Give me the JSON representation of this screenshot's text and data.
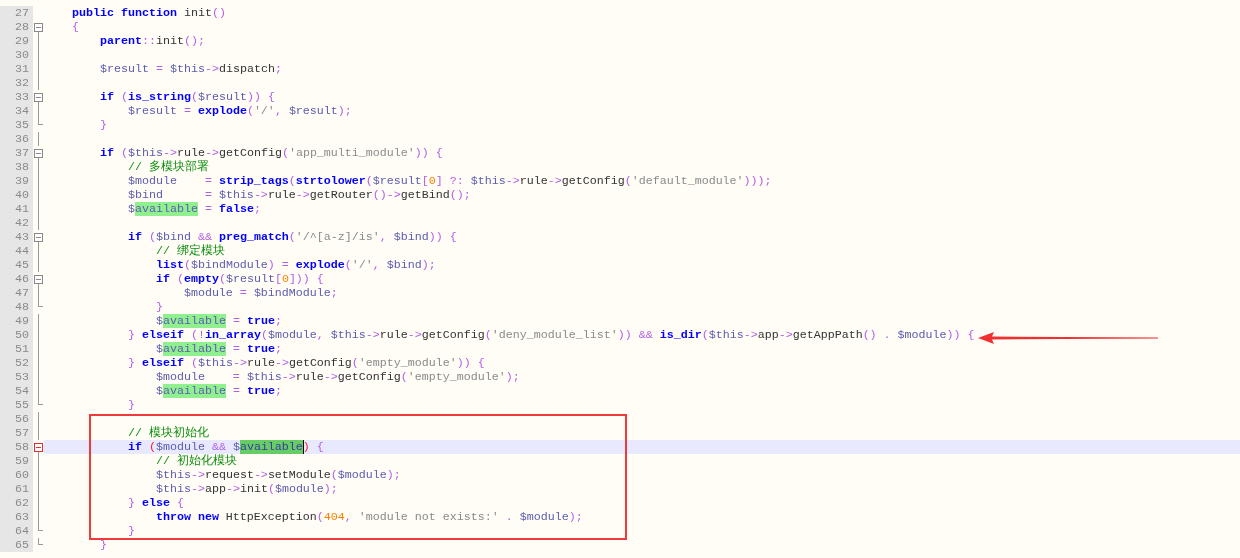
{
  "editor": {
    "lines": [
      {
        "n": "27",
        "foldable": false,
        "fold_end": false,
        "in_fold": false,
        "current": false,
        "tokens": [
          {
            "kind": "kw",
            "text": "    public function"
          },
          {
            "kind": "plain",
            "text": " init"
          },
          {
            "kind": "op",
            "text": "()"
          }
        ]
      },
      {
        "n": "28",
        "foldable": true,
        "fold_end": false,
        "in_fold": true,
        "current": false,
        "tokens": [
          {
            "kind": "op",
            "text": "    {"
          }
        ]
      },
      {
        "n": "29",
        "foldable": false,
        "fold_end": false,
        "in_fold": true,
        "current": false,
        "tokens": [
          {
            "kind": "kw",
            "text": "        parent"
          },
          {
            "kind": "op",
            "text": "::"
          },
          {
            "kind": "plain",
            "text": "init"
          },
          {
            "kind": "op",
            "text": "();"
          }
        ]
      },
      {
        "n": "30",
        "foldable": false,
        "fold_end": false,
        "in_fold": true,
        "current": false
      },
      {
        "n": "31",
        "foldable": false,
        "fold_end": false,
        "in_fold": true,
        "current": false,
        "tokens": [
          {
            "kind": "var",
            "text": "        $result"
          },
          {
            "kind": "op",
            "text": " = "
          },
          {
            "kind": "var",
            "text": "$this"
          },
          {
            "kind": "op",
            "text": "->"
          },
          {
            "kind": "plain",
            "text": "dispatch"
          },
          {
            "kind": "op",
            "text": ";"
          }
        ]
      },
      {
        "n": "32",
        "foldable": false,
        "fold_end": false,
        "in_fold": true,
        "current": false
      },
      {
        "n": "33",
        "foldable": true,
        "fold_end": false,
        "in_fold": true,
        "current": false,
        "tokens": [
          {
            "kind": "kw",
            "text": "        if"
          },
          {
            "kind": "op",
            "text": " ("
          },
          {
            "kind": "kw",
            "text": "is_string"
          },
          {
            "kind": "op",
            "text": "("
          },
          {
            "kind": "var",
            "text": "$result"
          },
          {
            "kind": "op",
            "text": ")) {"
          }
        ]
      },
      {
        "n": "34",
        "foldable": false,
        "fold_end": false,
        "in_fold": true,
        "current": false,
        "tokens": [
          {
            "kind": "var",
            "text": "            $result"
          },
          {
            "kind": "op",
            "text": " = "
          },
          {
            "kind": "kw",
            "text": "explode"
          },
          {
            "kind": "op",
            "text": "("
          },
          {
            "kind": "str",
            "text": "'/'"
          },
          {
            "kind": "op",
            "text": ", "
          },
          {
            "kind": "var",
            "text": "$result"
          },
          {
            "kind": "op",
            "text": ");"
          }
        ]
      },
      {
        "n": "35",
        "foldable": false,
        "fold_end": true,
        "in_fold": true,
        "current": false,
        "tokens": [
          {
            "kind": "op",
            "text": "        }"
          }
        ]
      },
      {
        "n": "36",
        "foldable": false,
        "fold_end": false,
        "in_fold": true,
        "current": false
      },
      {
        "n": "37",
        "foldable": true,
        "fold_end": false,
        "in_fold": true,
        "current": false,
        "tokens": [
          {
            "kind": "kw",
            "text": "        if"
          },
          {
            "kind": "op",
            "text": " ("
          },
          {
            "kind": "var",
            "text": "$this"
          },
          {
            "kind": "op",
            "text": "->"
          },
          {
            "kind": "plain",
            "text": "rule"
          },
          {
            "kind": "op",
            "text": "->"
          },
          {
            "kind": "plain",
            "text": "getConfig"
          },
          {
            "kind": "op",
            "text": "("
          },
          {
            "kind": "str",
            "text": "'app_multi_module'"
          },
          {
            "kind": "op",
            "text": ")) {"
          }
        ]
      },
      {
        "n": "38",
        "foldable": false,
        "fold_end": false,
        "in_fold": true,
        "current": false,
        "tokens": [
          {
            "kind": "cmt",
            "text": "            // 多模块部署"
          }
        ]
      },
      {
        "n": "39",
        "foldable": false,
        "fold_end": false,
        "in_fold": true,
        "current": false,
        "tokens": [
          {
            "kind": "var",
            "text": "            $module"
          },
          {
            "kind": "op",
            "text": "    = "
          },
          {
            "kind": "kw",
            "text": "strip_tags"
          },
          {
            "kind": "op",
            "text": "("
          },
          {
            "kind": "kw",
            "text": "strtolower"
          },
          {
            "kind": "op",
            "text": "("
          },
          {
            "kind": "var",
            "text": "$result"
          },
          {
            "kind": "op",
            "text": "["
          },
          {
            "kind": "num",
            "text": "0"
          },
          {
            "kind": "op",
            "text": "] ?: "
          },
          {
            "kind": "var",
            "text": "$this"
          },
          {
            "kind": "op",
            "text": "->"
          },
          {
            "kind": "plain",
            "text": "rule"
          },
          {
            "kind": "op",
            "text": "->"
          },
          {
            "kind": "plain",
            "text": "getConfig"
          },
          {
            "kind": "op",
            "text": "("
          },
          {
            "kind": "str",
            "text": "'default_module'"
          },
          {
            "kind": "op",
            "text": ")));"
          }
        ]
      },
      {
        "n": "40",
        "foldable": false,
        "fold_end": false,
        "in_fold": true,
        "current": false,
        "tokens": [
          {
            "kind": "var",
            "text": "            $bind"
          },
          {
            "kind": "op",
            "text": "      = "
          },
          {
            "kind": "var",
            "text": "$this"
          },
          {
            "kind": "op",
            "text": "->"
          },
          {
            "kind": "plain",
            "text": "rule"
          },
          {
            "kind": "op",
            "text": "->"
          },
          {
            "kind": "plain",
            "text": "getRouter"
          },
          {
            "kind": "op",
            "text": "()->"
          },
          {
            "kind": "plain",
            "text": "getBind"
          },
          {
            "kind": "op",
            "text": "();"
          }
        ]
      },
      {
        "n": "41",
        "foldable": false,
        "fold_end": false,
        "in_fold": true,
        "current": false,
        "tokens": [
          {
            "kind": "var",
            "text": "            $"
          },
          {
            "kind": "hl",
            "text": "available"
          },
          {
            "kind": "op",
            "text": " = "
          },
          {
            "kind": "kw",
            "text": "false"
          },
          {
            "kind": "op",
            "text": ";"
          }
        ]
      },
      {
        "n": "42",
        "foldable": false,
        "fold_end": false,
        "in_fold": true,
        "current": false
      },
      {
        "n": "43",
        "foldable": true,
        "fold_end": false,
        "in_fold": true,
        "current": false,
        "tokens": [
          {
            "kind": "kw",
            "text": "            if"
          },
          {
            "kind": "op",
            "text": " ("
          },
          {
            "kind": "var",
            "text": "$bind"
          },
          {
            "kind": "op",
            "text": " && "
          },
          {
            "kind": "kw",
            "text": "preg_match"
          },
          {
            "kind": "op",
            "text": "("
          },
          {
            "kind": "str",
            "text": "'/^[a-z]/is'"
          },
          {
            "kind": "op",
            "text": ", "
          },
          {
            "kind": "var",
            "text": "$bind"
          },
          {
            "kind": "op",
            "text": ")) {"
          }
        ]
      },
      {
        "n": "44",
        "foldable": false,
        "fold_end": false,
        "in_fold": true,
        "current": false,
        "tokens": [
          {
            "kind": "cmt",
            "text": "                // 绑定模块"
          }
        ]
      },
      {
        "n": "45",
        "foldable": false,
        "fold_end": false,
        "in_fold": true,
        "current": false,
        "tokens": [
          {
            "kind": "kw",
            "text": "                list"
          },
          {
            "kind": "op",
            "text": "("
          },
          {
            "kind": "var",
            "text": "$bindModule"
          },
          {
            "kind": "op",
            "text": ") = "
          },
          {
            "kind": "kw",
            "text": "explode"
          },
          {
            "kind": "op",
            "text": "("
          },
          {
            "kind": "str",
            "text": "'/'"
          },
          {
            "kind": "op",
            "text": ", "
          },
          {
            "kind": "var",
            "text": "$bind"
          },
          {
            "kind": "op",
            "text": ");"
          }
        ]
      },
      {
        "n": "46",
        "foldable": true,
        "fold_end": false,
        "in_fold": true,
        "current": false,
        "tokens": [
          {
            "kind": "kw",
            "text": "                if"
          },
          {
            "kind": "op",
            "text": " ("
          },
          {
            "kind": "kw",
            "text": "empty"
          },
          {
            "kind": "op",
            "text": "("
          },
          {
            "kind": "var",
            "text": "$result"
          },
          {
            "kind": "op",
            "text": "["
          },
          {
            "kind": "num",
            "text": "0"
          },
          {
            "kind": "op",
            "text": "])) {"
          }
        ]
      },
      {
        "n": "47",
        "foldable": false,
        "fold_end": false,
        "in_fold": true,
        "current": false,
        "tokens": [
          {
            "kind": "var",
            "text": "                    $module"
          },
          {
            "kind": "op",
            "text": " = "
          },
          {
            "kind": "var",
            "text": "$bindModule"
          },
          {
            "kind": "op",
            "text": ";"
          }
        ]
      },
      {
        "n": "48",
        "foldable": false,
        "fold_end": true,
        "in_fold": true,
        "current": false,
        "tokens": [
          {
            "kind": "op",
            "text": "                }"
          }
        ]
      },
      {
        "n": "49",
        "foldable": false,
        "fold_end": false,
        "in_fold": true,
        "current": false,
        "tokens": [
          {
            "kind": "var",
            "text": "                $"
          },
          {
            "kind": "hl",
            "text": "available"
          },
          {
            "kind": "op",
            "text": " = "
          },
          {
            "kind": "kw",
            "text": "true"
          },
          {
            "kind": "op",
            "text": ";"
          }
        ]
      },
      {
        "n": "50",
        "foldable": false,
        "fold_end": false,
        "in_fold": true,
        "current": false,
        "tokens": [
          {
            "kind": "op",
            "text": "            } "
          },
          {
            "kind": "kw",
            "text": "elseif"
          },
          {
            "kind": "op",
            "text": " (!"
          },
          {
            "kind": "kw",
            "text": "in_array"
          },
          {
            "kind": "op",
            "text": "("
          },
          {
            "kind": "var",
            "text": "$module"
          },
          {
            "kind": "op",
            "text": ", "
          },
          {
            "kind": "var",
            "text": "$this"
          },
          {
            "kind": "op",
            "text": "->"
          },
          {
            "kind": "plain",
            "text": "rule"
          },
          {
            "kind": "op",
            "text": "->"
          },
          {
            "kind": "plain",
            "text": "getConfig"
          },
          {
            "kind": "op",
            "text": "("
          },
          {
            "kind": "str",
            "text": "'deny_module_list'"
          },
          {
            "kind": "op",
            "text": ")) && "
          },
          {
            "kind": "kw",
            "text": "is_dir"
          },
          {
            "kind": "op",
            "text": "("
          },
          {
            "kind": "var",
            "text": "$this"
          },
          {
            "kind": "op",
            "text": "->"
          },
          {
            "kind": "plain",
            "text": "app"
          },
          {
            "kind": "op",
            "text": "->"
          },
          {
            "kind": "plain",
            "text": "getAppPath"
          },
          {
            "kind": "op",
            "text": "() . "
          },
          {
            "kind": "var",
            "text": "$module"
          },
          {
            "kind": "op",
            "text": ")) {"
          }
        ]
      },
      {
        "n": "51",
        "foldable": false,
        "fold_end": false,
        "in_fold": true,
        "current": false,
        "tokens": [
          {
            "kind": "var",
            "text": "                $"
          },
          {
            "kind": "hl",
            "text": "available"
          },
          {
            "kind": "op",
            "text": " = "
          },
          {
            "kind": "kw",
            "text": "true"
          },
          {
            "kind": "op",
            "text": ";"
          }
        ]
      },
      {
        "n": "52",
        "foldable": false,
        "fold_end": false,
        "in_fold": true,
        "current": false,
        "tokens": [
          {
            "kind": "op",
            "text": "            } "
          },
          {
            "kind": "kw",
            "text": "elseif"
          },
          {
            "kind": "op",
            "text": " ("
          },
          {
            "kind": "var",
            "text": "$this"
          },
          {
            "kind": "op",
            "text": "->"
          },
          {
            "kind": "plain",
            "text": "rule"
          },
          {
            "kind": "op",
            "text": "->"
          },
          {
            "kind": "plain",
            "text": "getConfig"
          },
          {
            "kind": "op",
            "text": "("
          },
          {
            "kind": "str",
            "text": "'empty_module'"
          },
          {
            "kind": "op",
            "text": ")) {"
          }
        ]
      },
      {
        "n": "53",
        "foldable": false,
        "fold_end": false,
        "in_fold": true,
        "current": false,
        "tokens": [
          {
            "kind": "var",
            "text": "                $module"
          },
          {
            "kind": "op",
            "text": "    = "
          },
          {
            "kind": "var",
            "text": "$this"
          },
          {
            "kind": "op",
            "text": "->"
          },
          {
            "kind": "plain",
            "text": "rule"
          },
          {
            "kind": "op",
            "text": "->"
          },
          {
            "kind": "plain",
            "text": "getConfig"
          },
          {
            "kind": "op",
            "text": "("
          },
          {
            "kind": "str",
            "text": "'empty_module'"
          },
          {
            "kind": "op",
            "text": ");"
          }
        ]
      },
      {
        "n": "54",
        "foldable": false,
        "fold_end": false,
        "in_fold": true,
        "current": false,
        "tokens": [
          {
            "kind": "var",
            "text": "                $"
          },
          {
            "kind": "hl",
            "text": "available"
          },
          {
            "kind": "op",
            "text": " = "
          },
          {
            "kind": "kw",
            "text": "true"
          },
          {
            "kind": "op",
            "text": ";"
          }
        ]
      },
      {
        "n": "55",
        "foldable": false,
        "fold_end": true,
        "in_fold": true,
        "current": false,
        "tokens": [
          {
            "kind": "op",
            "text": "            }"
          }
        ]
      },
      {
        "n": "56",
        "foldable": false,
        "fold_end": false,
        "in_fold": true,
        "current": false
      },
      {
        "n": "57",
        "foldable": false,
        "fold_end": false,
        "in_fold": true,
        "current": false,
        "tokens": [
          {
            "kind": "cmt",
            "text": "            // 模块初始化"
          }
        ]
      },
      {
        "n": "58",
        "foldable": true,
        "fold_end": false,
        "in_fold": true,
        "current": true,
        "tokens": [
          {
            "kind": "kw",
            "text": "            if "
          },
          {
            "kind": "brace",
            "text": "("
          },
          {
            "kind": "var",
            "text": "$module"
          },
          {
            "kind": "op",
            "text": " && "
          },
          {
            "kind": "var",
            "text": "$"
          },
          {
            "kind": "match",
            "text": "available"
          },
          {
            "kind": "brace",
            "text": ")"
          },
          {
            "kind": "op",
            "text": " {"
          }
        ]
      },
      {
        "n": "59",
        "foldable": false,
        "fold_end": false,
        "in_fold": true,
        "current": false,
        "tokens": [
          {
            "kind": "cmt",
            "text": "                // 初始化模块"
          }
        ]
      },
      {
        "n": "60",
        "foldable": false,
        "fold_end": false,
        "in_fold": true,
        "current": false,
        "tokens": [
          {
            "kind": "var",
            "text": "                $this"
          },
          {
            "kind": "op",
            "text": "->"
          },
          {
            "kind": "plain",
            "text": "request"
          },
          {
            "kind": "op",
            "text": "->"
          },
          {
            "kind": "plain",
            "text": "setModule"
          },
          {
            "kind": "op",
            "text": "("
          },
          {
            "kind": "var",
            "text": "$module"
          },
          {
            "kind": "op",
            "text": ");"
          }
        ]
      },
      {
        "n": "61",
        "foldable": false,
        "fold_end": false,
        "in_fold": true,
        "current": false,
        "tokens": [
          {
            "kind": "var",
            "text": "                $this"
          },
          {
            "kind": "op",
            "text": "->"
          },
          {
            "kind": "plain",
            "text": "app"
          },
          {
            "kind": "op",
            "text": "->"
          },
          {
            "kind": "plain",
            "text": "init"
          },
          {
            "kind": "op",
            "text": "("
          },
          {
            "kind": "var",
            "text": "$module"
          },
          {
            "kind": "op",
            "text": ");"
          }
        ]
      },
      {
        "n": "62",
        "foldable": false,
        "fold_end": false,
        "in_fold": true,
        "current": false,
        "tokens": [
          {
            "kind": "op",
            "text": "            } "
          },
          {
            "kind": "kw",
            "text": "else"
          },
          {
            "kind": "op",
            "text": " {"
          }
        ]
      },
      {
        "n": "63",
        "foldable": false,
        "fold_end": false,
        "in_fold": true,
        "current": false,
        "tokens": [
          {
            "kind": "kw",
            "text": "                throw new"
          },
          {
            "kind": "plain",
            "text": " HttpException"
          },
          {
            "kind": "op",
            "text": "("
          },
          {
            "kind": "num",
            "text": "404"
          },
          {
            "kind": "op",
            "text": ", "
          },
          {
            "kind": "str",
            "text": "'module not exists:'"
          },
          {
            "kind": "op",
            "text": " . "
          },
          {
            "kind": "var",
            "text": "$module"
          },
          {
            "kind": "op",
            "text": ");"
          }
        ]
      },
      {
        "n": "64",
        "foldable": false,
        "fold_end": true,
        "in_fold": true,
        "current": false,
        "tokens": [
          {
            "kind": "op",
            "text": "            }"
          }
        ]
      },
      {
        "n": "65",
        "foldable": false,
        "fold_end": true,
        "in_fold": true,
        "current": false,
        "tokens": [
          {
            "kind": "op",
            "text": "        }"
          }
        ]
      }
    ]
  }
}
